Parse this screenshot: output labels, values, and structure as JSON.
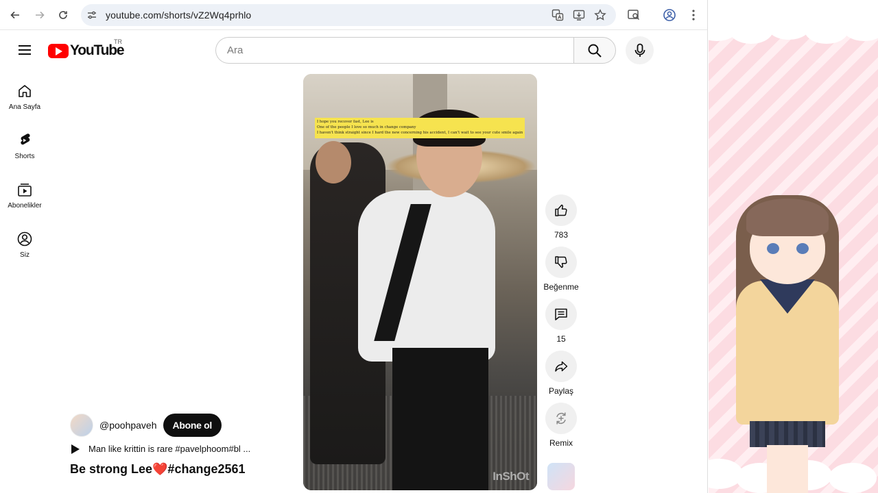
{
  "browser": {
    "url": "youtube.com/shorts/vZ2Wq4prhlo"
  },
  "youtube": {
    "logo_text": "YouTube",
    "region": "TR",
    "search_placeholder": "Ara"
  },
  "sidebar": {
    "items": [
      {
        "label": "Ana Sayfa",
        "icon": "home-icon"
      },
      {
        "label": "Shorts",
        "icon": "shorts-icon"
      },
      {
        "label": "Abonelikler",
        "icon": "subscriptions-icon"
      },
      {
        "label": "Siz",
        "icon": "account-icon"
      }
    ]
  },
  "video": {
    "caption_lines": [
      "I hope you recover fast, Lee is",
      "One of the people I love so much in change company",
      "I haven't think straight since I hard the new concerning his accident, I can't wait to see your cute smile again"
    ],
    "watermark": "InShOt"
  },
  "actions": {
    "like_count": "783",
    "dislike_label": "Beğenme",
    "comment_count": "15",
    "share_label": "Paylaş",
    "remix_label": "Remix"
  },
  "channel": {
    "handle": "@poohpaveh",
    "subscribe_label": "Abone ol"
  },
  "audio": {
    "text": "Man like krittin is rare  #pavelphoom#bl ..."
  },
  "short": {
    "title": "Be strong Lee❤️#change2561"
  }
}
